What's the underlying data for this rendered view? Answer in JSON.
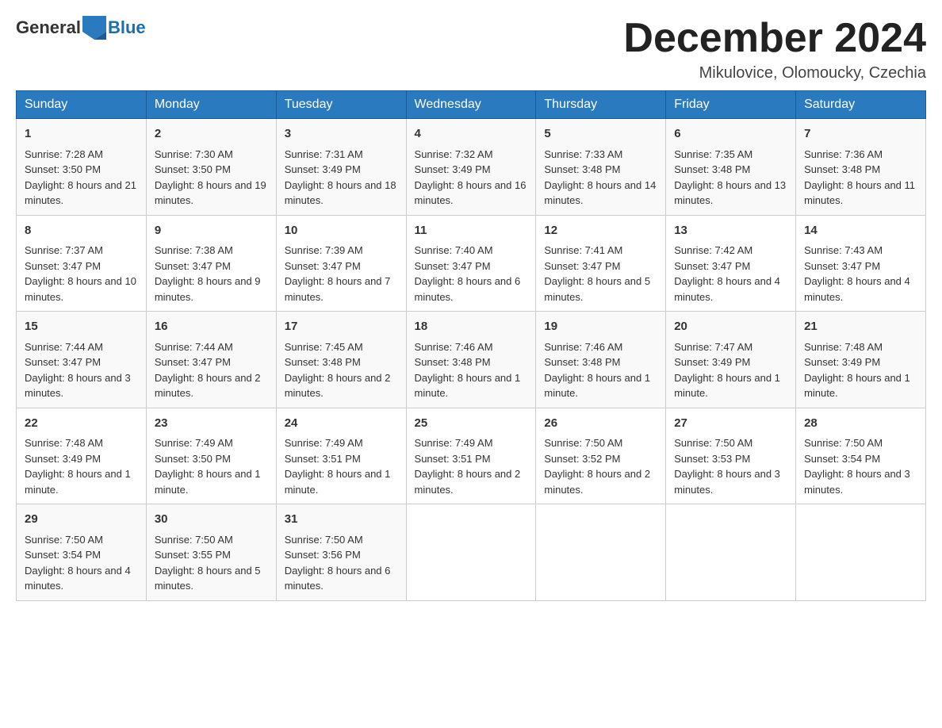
{
  "header": {
    "logo_text_general": "General",
    "logo_text_blue": "Blue",
    "month_title": "December 2024",
    "location": "Mikulovice, Olomoucky, Czechia"
  },
  "days_of_week": [
    "Sunday",
    "Monday",
    "Tuesday",
    "Wednesday",
    "Thursday",
    "Friday",
    "Saturday"
  ],
  "weeks": [
    [
      {
        "day": "1",
        "sunrise": "7:28 AM",
        "sunset": "3:50 PM",
        "daylight": "8 hours and 21 minutes."
      },
      {
        "day": "2",
        "sunrise": "7:30 AM",
        "sunset": "3:50 PM",
        "daylight": "8 hours and 19 minutes."
      },
      {
        "day": "3",
        "sunrise": "7:31 AM",
        "sunset": "3:49 PM",
        "daylight": "8 hours and 18 minutes."
      },
      {
        "day": "4",
        "sunrise": "7:32 AM",
        "sunset": "3:49 PM",
        "daylight": "8 hours and 16 minutes."
      },
      {
        "day": "5",
        "sunrise": "7:33 AM",
        "sunset": "3:48 PM",
        "daylight": "8 hours and 14 minutes."
      },
      {
        "day": "6",
        "sunrise": "7:35 AM",
        "sunset": "3:48 PM",
        "daylight": "8 hours and 13 minutes."
      },
      {
        "day": "7",
        "sunrise": "7:36 AM",
        "sunset": "3:48 PM",
        "daylight": "8 hours and 11 minutes."
      }
    ],
    [
      {
        "day": "8",
        "sunrise": "7:37 AM",
        "sunset": "3:47 PM",
        "daylight": "8 hours and 10 minutes."
      },
      {
        "day": "9",
        "sunrise": "7:38 AM",
        "sunset": "3:47 PM",
        "daylight": "8 hours and 9 minutes."
      },
      {
        "day": "10",
        "sunrise": "7:39 AM",
        "sunset": "3:47 PM",
        "daylight": "8 hours and 7 minutes."
      },
      {
        "day": "11",
        "sunrise": "7:40 AM",
        "sunset": "3:47 PM",
        "daylight": "8 hours and 6 minutes."
      },
      {
        "day": "12",
        "sunrise": "7:41 AM",
        "sunset": "3:47 PM",
        "daylight": "8 hours and 5 minutes."
      },
      {
        "day": "13",
        "sunrise": "7:42 AM",
        "sunset": "3:47 PM",
        "daylight": "8 hours and 4 minutes."
      },
      {
        "day": "14",
        "sunrise": "7:43 AM",
        "sunset": "3:47 PM",
        "daylight": "8 hours and 4 minutes."
      }
    ],
    [
      {
        "day": "15",
        "sunrise": "7:44 AM",
        "sunset": "3:47 PM",
        "daylight": "8 hours and 3 minutes."
      },
      {
        "day": "16",
        "sunrise": "7:44 AM",
        "sunset": "3:47 PM",
        "daylight": "8 hours and 2 minutes."
      },
      {
        "day": "17",
        "sunrise": "7:45 AM",
        "sunset": "3:48 PM",
        "daylight": "8 hours and 2 minutes."
      },
      {
        "day": "18",
        "sunrise": "7:46 AM",
        "sunset": "3:48 PM",
        "daylight": "8 hours and 1 minute."
      },
      {
        "day": "19",
        "sunrise": "7:46 AM",
        "sunset": "3:48 PM",
        "daylight": "8 hours and 1 minute."
      },
      {
        "day": "20",
        "sunrise": "7:47 AM",
        "sunset": "3:49 PM",
        "daylight": "8 hours and 1 minute."
      },
      {
        "day": "21",
        "sunrise": "7:48 AM",
        "sunset": "3:49 PM",
        "daylight": "8 hours and 1 minute."
      }
    ],
    [
      {
        "day": "22",
        "sunrise": "7:48 AM",
        "sunset": "3:49 PM",
        "daylight": "8 hours and 1 minute."
      },
      {
        "day": "23",
        "sunrise": "7:49 AM",
        "sunset": "3:50 PM",
        "daylight": "8 hours and 1 minute."
      },
      {
        "day": "24",
        "sunrise": "7:49 AM",
        "sunset": "3:51 PM",
        "daylight": "8 hours and 1 minute."
      },
      {
        "day": "25",
        "sunrise": "7:49 AM",
        "sunset": "3:51 PM",
        "daylight": "8 hours and 2 minutes."
      },
      {
        "day": "26",
        "sunrise": "7:50 AM",
        "sunset": "3:52 PM",
        "daylight": "8 hours and 2 minutes."
      },
      {
        "day": "27",
        "sunrise": "7:50 AM",
        "sunset": "3:53 PM",
        "daylight": "8 hours and 3 minutes."
      },
      {
        "day": "28",
        "sunrise": "7:50 AM",
        "sunset": "3:54 PM",
        "daylight": "8 hours and 3 minutes."
      }
    ],
    [
      {
        "day": "29",
        "sunrise": "7:50 AM",
        "sunset": "3:54 PM",
        "daylight": "8 hours and 4 minutes."
      },
      {
        "day": "30",
        "sunrise": "7:50 AM",
        "sunset": "3:55 PM",
        "daylight": "8 hours and 5 minutes."
      },
      {
        "day": "31",
        "sunrise": "7:50 AM",
        "sunset": "3:56 PM",
        "daylight": "8 hours and 6 minutes."
      },
      null,
      null,
      null,
      null
    ]
  ]
}
